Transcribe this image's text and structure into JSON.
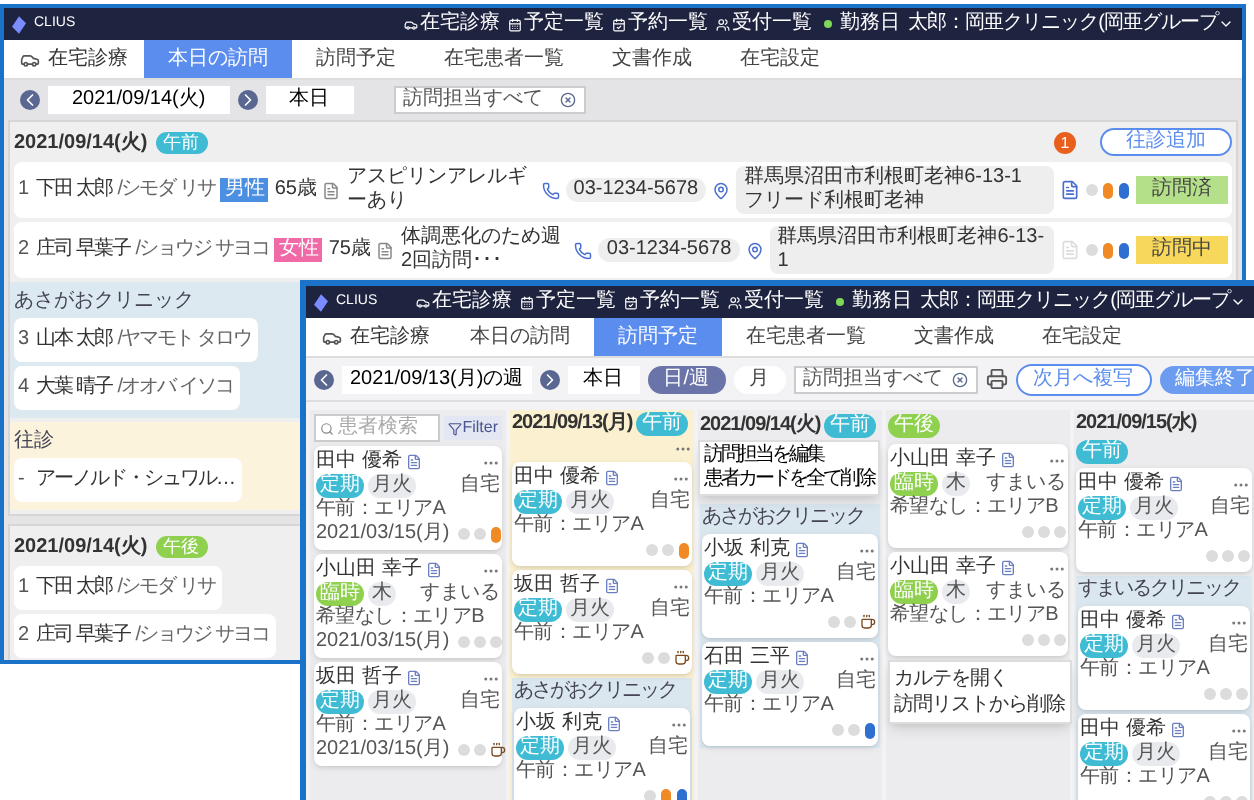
{
  "back_window": {
    "brand": "CLIUS",
    "top_nav": [
      {
        "label": "在宅診療",
        "kind": "car"
      },
      {
        "label": "予定一覧",
        "kind": "calendar"
      },
      {
        "label": "予約一覧",
        "kind": "booking"
      },
      {
        "label": "受付一覧",
        "kind": "people"
      }
    ],
    "day_status": "勤務日",
    "user": "太郎：岡亜クリニック(岡亜グループ",
    "page_title": "在宅診療",
    "tabs": [
      {
        "label": "本日の訪問",
        "selected": true
      },
      {
        "label": "訪問予定",
        "selected": false
      },
      {
        "label": "在宅患者一覧",
        "selected": false
      },
      {
        "label": "文書作成",
        "selected": false
      },
      {
        "label": "在宅設定",
        "selected": false
      }
    ],
    "date": "2021/09/14(火)",
    "today_button": "本日",
    "filter": "訪問担当すべて",
    "sections": [
      {
        "date": "2021/09/14(火)",
        "period": {
          "label": "午前",
          "kind": "am"
        },
        "alert_count": "1",
        "add_button": "往診追加",
        "groups": [
          {
            "kind": "plain",
            "rows": [
              {
                "no": "1",
                "name": "下田 太郎",
                "kana": "/シモダ リサ",
                "gender": {
                  "label": "男性",
                  "kind": "male"
                },
                "age": "65歳",
                "note": "アスピリンアレルギーあり",
                "phone": "03-1234-5678",
                "address": "群馬県沼田市利根町老神6-13-1 フリード利根町老神",
                "record": true,
                "indicators": [
                  {
                    "kind": "dot"
                  },
                  {
                    "kind": "pill",
                    "color": "#f08a24"
                  },
                  {
                    "kind": "pill",
                    "color": "#2f6fd0"
                  }
                ],
                "status": {
                  "label": "訪問済",
                  "kind": "done"
                }
              },
              {
                "no": "2",
                "name": "庄司 早葉子",
                "kana": "/ショウジ サヨコ",
                "gender": {
                  "label": "女性",
                  "kind": "female"
                },
                "age": "75歳",
                "note": "体調悪化のため週2回訪問･･･",
                "phone": "03-1234-5678",
                "address": "群馬県沼田市利根町老神6-13-1",
                "record": false,
                "indicators": [
                  {
                    "kind": "dot"
                  },
                  {
                    "kind": "pill",
                    "color": "#f08a24"
                  },
                  {
                    "kind": "pill",
                    "color": "#2f6fd0"
                  }
                ],
                "status": {
                  "label": "訪問中",
                  "kind": "in_progress"
                }
              }
            ]
          },
          {
            "kind": "clinic",
            "title": "あさがおクリニック",
            "rows": [
              {
                "no": "3",
                "name": "山本 太郎",
                "kana": "/ヤマモト タロウ"
              },
              {
                "no": "4",
                "name": "大葉 晴子",
                "kana": "/オオバ イソコ"
              }
            ]
          },
          {
            "kind": "house_call",
            "title": "往診",
            "rows": [
              {
                "no": "-",
                "name": "アーノルド・シュワル…"
              }
            ]
          }
        ]
      },
      {
        "date": "2021/09/14(火)",
        "period": {
          "label": "午後",
          "kind": "pm"
        },
        "groups": [
          {
            "kind": "plain",
            "rows": [
              {
                "no": "1",
                "name": "下田 太郎",
                "kana": "/シモダ リサ"
              },
              {
                "no": "2",
                "name": "庄司 早葉子",
                "kana": "/ショウジ サヨコ"
              }
            ]
          }
        ]
      }
    ]
  },
  "front_window": {
    "brand": "CLIUS",
    "top_nav": [
      {
        "label": "在宅診療",
        "kind": "car"
      },
      {
        "label": "予定一覧",
        "kind": "calendar"
      },
      {
        "label": "予約一覧",
        "kind": "booking"
      },
      {
        "label": "受付一覧",
        "kind": "people"
      }
    ],
    "day_status": "勤務日",
    "user": "太郎：岡亜クリニック(岡亜グループ",
    "page_title": "在宅診療",
    "tabs": [
      {
        "label": "本日の訪問",
        "selected": false
      },
      {
        "label": "訪問予定",
        "selected": true
      },
      {
        "label": "在宅患者一覧",
        "selected": false
      },
      {
        "label": "文書作成",
        "selected": false
      },
      {
        "label": "在宅設定",
        "selected": false
      }
    ],
    "week": "2021/09/13(月)の週",
    "today_button": "本日",
    "view_toggle": [
      {
        "label": "日/週",
        "selected": true
      },
      {
        "label": "月",
        "selected": false
      }
    ],
    "filter": "訪問担当すべて",
    "copy_button": "次月へ複写",
    "finish_button": "編集終了",
    "search_placeholder": "患者検索",
    "filter_button": "Filter",
    "patient_list": [
      {
        "name": "田中 優希",
        "place": "自宅",
        "tags": [
          {
            "label": "定期",
            "kind": "regular"
          },
          {
            "label": "月火",
            "kind": "day"
          }
        ],
        "footer": "午前：エリアA",
        "date": "2021/03/15(月)",
        "indicators": [
          {
            "kind": "dot"
          },
          {
            "kind": "dot"
          },
          {
            "kind": "pill",
            "color": "#f08a24"
          }
        ]
      },
      {
        "name": "小山田 幸子",
        "place": "すまいる",
        "tags": [
          {
            "label": "臨時",
            "kind": "temporary"
          },
          {
            "label": "木",
            "kind": "day"
          }
        ],
        "footer": "希望なし：エリアB",
        "date": "2021/03/15(月)",
        "indicators": [
          {
            "kind": "dot"
          },
          {
            "kind": "dot"
          },
          {
            "kind": "dot"
          }
        ]
      },
      {
        "name": "坂田 哲子",
        "place": "自宅",
        "tags": [
          {
            "label": "定期",
            "kind": "regular"
          },
          {
            "label": "月火",
            "kind": "day"
          }
        ],
        "footer": "午前：エリアA",
        "date": "2021/03/15(月)",
        "indicators": [
          {
            "kind": "dot"
          },
          {
            "kind": "dot"
          },
          {
            "kind": "cup"
          }
        ]
      }
    ],
    "columns": [
      {
        "date": "2021/09/13(月)",
        "period": {
          "label": "午前",
          "kind": "am"
        },
        "highlighted": true,
        "menu": [
          "訪問担当を編集",
          "患者カードを全て削除"
        ],
        "items": [
          {
            "kind": "card",
            "name": "田中 優希",
            "place": "自宅",
            "tags": [
              {
                "label": "定期",
                "kind": "regular"
              },
              {
                "label": "月火",
                "kind": "day"
              }
            ],
            "footer": "午前：エリアA",
            "indicators": [
              {
                "kind": "dot"
              },
              {
                "kind": "dot"
              },
              {
                "kind": "pill",
                "color": "#f08a24"
              }
            ]
          },
          {
            "kind": "card",
            "name": "坂田 哲子",
            "place": "自宅",
            "tags": [
              {
                "label": "定期",
                "kind": "regular"
              },
              {
                "label": "月火",
                "kind": "day"
              }
            ],
            "footer": "午前：エリアA",
            "indicators": [
              {
                "kind": "dot"
              },
              {
                "kind": "dot"
              },
              {
                "kind": "cup"
              }
            ]
          },
          {
            "kind": "group",
            "title": "あさがおクリニック",
            "cards": [
              {
                "name": "小坂 利克",
                "place": "自宅",
                "tags": [
                  {
                    "label": "定期",
                    "kind": "regular"
                  },
                  {
                    "label": "月火",
                    "kind": "day"
                  }
                ],
                "footer": "午前：エリアA",
                "indicators": [
                  {
                    "kind": "dot"
                  },
                  {
                    "kind": "pill",
                    "color": "#f08a24"
                  },
                  {
                    "kind": "pill",
                    "color": "#2f6fd0"
                  }
                ]
              }
            ]
          }
        ]
      },
      {
        "date": "2021/09/14(火)",
        "period": {
          "label": "午前",
          "kind": "am"
        },
        "highlighted": false,
        "items": [
          {
            "kind": "group",
            "title": "あさがおクリニック",
            "cards": [
              {
                "name": "小坂 利克",
                "place": "自宅",
                "tags": [
                  {
                    "label": "定期",
                    "kind": "regular"
                  },
                  {
                    "label": "月火",
                    "kind": "day"
                  }
                ],
                "footer": "午前：エリアA",
                "indicators": [
                  {
                    "kind": "dot"
                  },
                  {
                    "kind": "dot"
                  },
                  {
                    "kind": "cup"
                  }
                ]
              },
              {
                "name": "石田 三平",
                "place": "自宅",
                "tags": [
                  {
                    "label": "定期",
                    "kind": "regular"
                  },
                  {
                    "label": "月火",
                    "kind": "day"
                  }
                ],
                "footer": "午前：エリアA",
                "indicators": [
                  {
                    "kind": "dot"
                  },
                  {
                    "kind": "dot"
                  },
                  {
                    "kind": "pill",
                    "color": "#2f6fd0"
                  }
                ]
              }
            ]
          }
        ]
      },
      {
        "period": {
          "label": "午後",
          "kind": "pm"
        },
        "highlighted": false,
        "items": [
          {
            "kind": "card",
            "name": "小山田 幸子",
            "place": "すまいる",
            "tags": [
              {
                "label": "臨時",
                "kind": "temporary"
              },
              {
                "label": "木",
                "kind": "day"
              }
            ],
            "footer": "希望なし：エリアB",
            "indicators": [
              {
                "kind": "dot"
              },
              {
                "kind": "dot"
              },
              {
                "kind": "dot"
              }
            ]
          },
          {
            "kind": "card",
            "name": "小山田 幸子",
            "place": "すまいる",
            "tags": [
              {
                "label": "臨時",
                "kind": "temporary"
              },
              {
                "label": "木",
                "kind": "day"
              }
            ],
            "footer": "希望なし：エリアB",
            "indicators": [
              {
                "kind": "dot"
              },
              {
                "kind": "dot"
              },
              {
                "kind": "dot"
              }
            ],
            "menu": [
              "カルテを開く",
              "訪問リストから削除"
            ]
          }
        ]
      },
      {
        "date": "2021/09/15(水)",
        "period": {
          "label": "午前",
          "kind": "am"
        },
        "highlighted": false,
        "items": [
          {
            "kind": "card",
            "name": "田中 優希",
            "place": "自宅",
            "tags": [
              {
                "label": "定期",
                "kind": "regular"
              },
              {
                "label": "月火",
                "kind": "day"
              }
            ],
            "footer": "午前：エリアA",
            "indicators": [
              {
                "kind": "dot"
              },
              {
                "kind": "dot"
              },
              {
                "kind": "dot"
              }
            ]
          },
          {
            "kind": "group",
            "title": "すまいるクリニック",
            "cards": [
              {
                "name": "田中 優希",
                "place": "自宅",
                "tags": [
                  {
                    "label": "定期",
                    "kind": "regular"
                  },
                  {
                    "label": "月火",
                    "kind": "day"
                  }
                ],
                "footer": "午前：エリアA",
                "indicators": [
                  {
                    "kind": "dot"
                  },
                  {
                    "kind": "dot"
                  },
                  {
                    "kind": "dot"
                  }
                ]
              },
              {
                "name": "田中 優希",
                "place": "自宅",
                "tags": [
                  {
                    "label": "定期",
                    "kind": "regular"
                  },
                  {
                    "label": "月火",
                    "kind": "day"
                  }
                ],
                "footer": "午前：エリアA",
                "indicators": [
                  {
                    "kind": "dot"
                  },
                  {
                    "kind": "dot"
                  },
                  {
                    "kind": "dot"
                  }
                ]
              }
            ]
          }
        ]
      }
    ]
  }
}
